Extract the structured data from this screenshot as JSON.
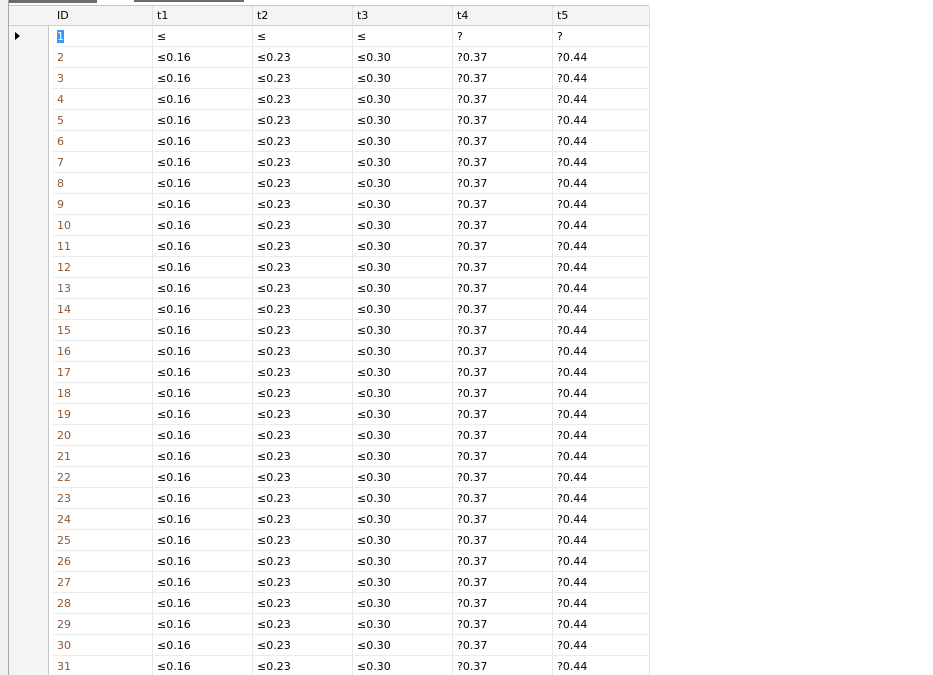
{
  "columns": [
    "ID",
    "t1",
    "t2",
    "t3",
    "t4",
    "t5"
  ],
  "rows": [
    [
      "1",
      "≤",
      "≤",
      "≤",
      "?",
      "?"
    ],
    [
      "2",
      "≤0.16",
      "≤0.23",
      "≤0.30",
      "?0.37",
      "?0.44"
    ],
    [
      "3",
      "≤0.16",
      "≤0.23",
      "≤0.30",
      "?0.37",
      "?0.44"
    ],
    [
      "4",
      "≤0.16",
      "≤0.23",
      "≤0.30",
      "?0.37",
      "?0.44"
    ],
    [
      "5",
      "≤0.16",
      "≤0.23",
      "≤0.30",
      "?0.37",
      "?0.44"
    ],
    [
      "6",
      "≤0.16",
      "≤0.23",
      "≤0.30",
      "?0.37",
      "?0.44"
    ],
    [
      "7",
      "≤0.16",
      "≤0.23",
      "≤0.30",
      "?0.37",
      "?0.44"
    ],
    [
      "8",
      "≤0.16",
      "≤0.23",
      "≤0.30",
      "?0.37",
      "?0.44"
    ],
    [
      "9",
      "≤0.16",
      "≤0.23",
      "≤0.30",
      "?0.37",
      "?0.44"
    ],
    [
      "10",
      "≤0.16",
      "≤0.23",
      "≤0.30",
      "?0.37",
      "?0.44"
    ],
    [
      "11",
      "≤0.16",
      "≤0.23",
      "≤0.30",
      "?0.37",
      "?0.44"
    ],
    [
      "12",
      "≤0.16",
      "≤0.23",
      "≤0.30",
      "?0.37",
      "?0.44"
    ],
    [
      "13",
      "≤0.16",
      "≤0.23",
      "≤0.30",
      "?0.37",
      "?0.44"
    ],
    [
      "14",
      "≤0.16",
      "≤0.23",
      "≤0.30",
      "?0.37",
      "?0.44"
    ],
    [
      "15",
      "≤0.16",
      "≤0.23",
      "≤0.30",
      "?0.37",
      "?0.44"
    ],
    [
      "16",
      "≤0.16",
      "≤0.23",
      "≤0.30",
      "?0.37",
      "?0.44"
    ],
    [
      "17",
      "≤0.16",
      "≤0.23",
      "≤0.30",
      "?0.37",
      "?0.44"
    ],
    [
      "18",
      "≤0.16",
      "≤0.23",
      "≤0.30",
      "?0.37",
      "?0.44"
    ],
    [
      "19",
      "≤0.16",
      "≤0.23",
      "≤0.30",
      "?0.37",
      "?0.44"
    ],
    [
      "20",
      "≤0.16",
      "≤0.23",
      "≤0.30",
      "?0.37",
      "?0.44"
    ],
    [
      "21",
      "≤0.16",
      "≤0.23",
      "≤0.30",
      "?0.37",
      "?0.44"
    ],
    [
      "22",
      "≤0.16",
      "≤0.23",
      "≤0.30",
      "?0.37",
      "?0.44"
    ],
    [
      "23",
      "≤0.16",
      "≤0.23",
      "≤0.30",
      "?0.37",
      "?0.44"
    ],
    [
      "24",
      "≤0.16",
      "≤0.23",
      "≤0.30",
      "?0.37",
      "?0.44"
    ],
    [
      "25",
      "≤0.16",
      "≤0.23",
      "≤0.30",
      "?0.37",
      "?0.44"
    ],
    [
      "26",
      "≤0.16",
      "≤0.23",
      "≤0.30",
      "?0.37",
      "?0.44"
    ],
    [
      "27",
      "≤0.16",
      "≤0.23",
      "≤0.30",
      "?0.37",
      "?0.44"
    ],
    [
      "28",
      "≤0.16",
      "≤0.23",
      "≤0.30",
      "?0.37",
      "?0.44"
    ],
    [
      "29",
      "≤0.16",
      "≤0.23",
      "≤0.30",
      "?0.37",
      "?0.44"
    ],
    [
      "30",
      "≤0.16",
      "≤0.23",
      "≤0.30",
      "?0.37",
      "?0.44"
    ],
    [
      "31",
      "≤0.16",
      "≤0.23",
      "≤0.30",
      "?0.37",
      "?0.44"
    ]
  ],
  "selected_row": 0,
  "colors": {
    "id_text": "#8a5a3a",
    "selection": "#3399ff",
    "header_bg": "#f4f4f4"
  }
}
